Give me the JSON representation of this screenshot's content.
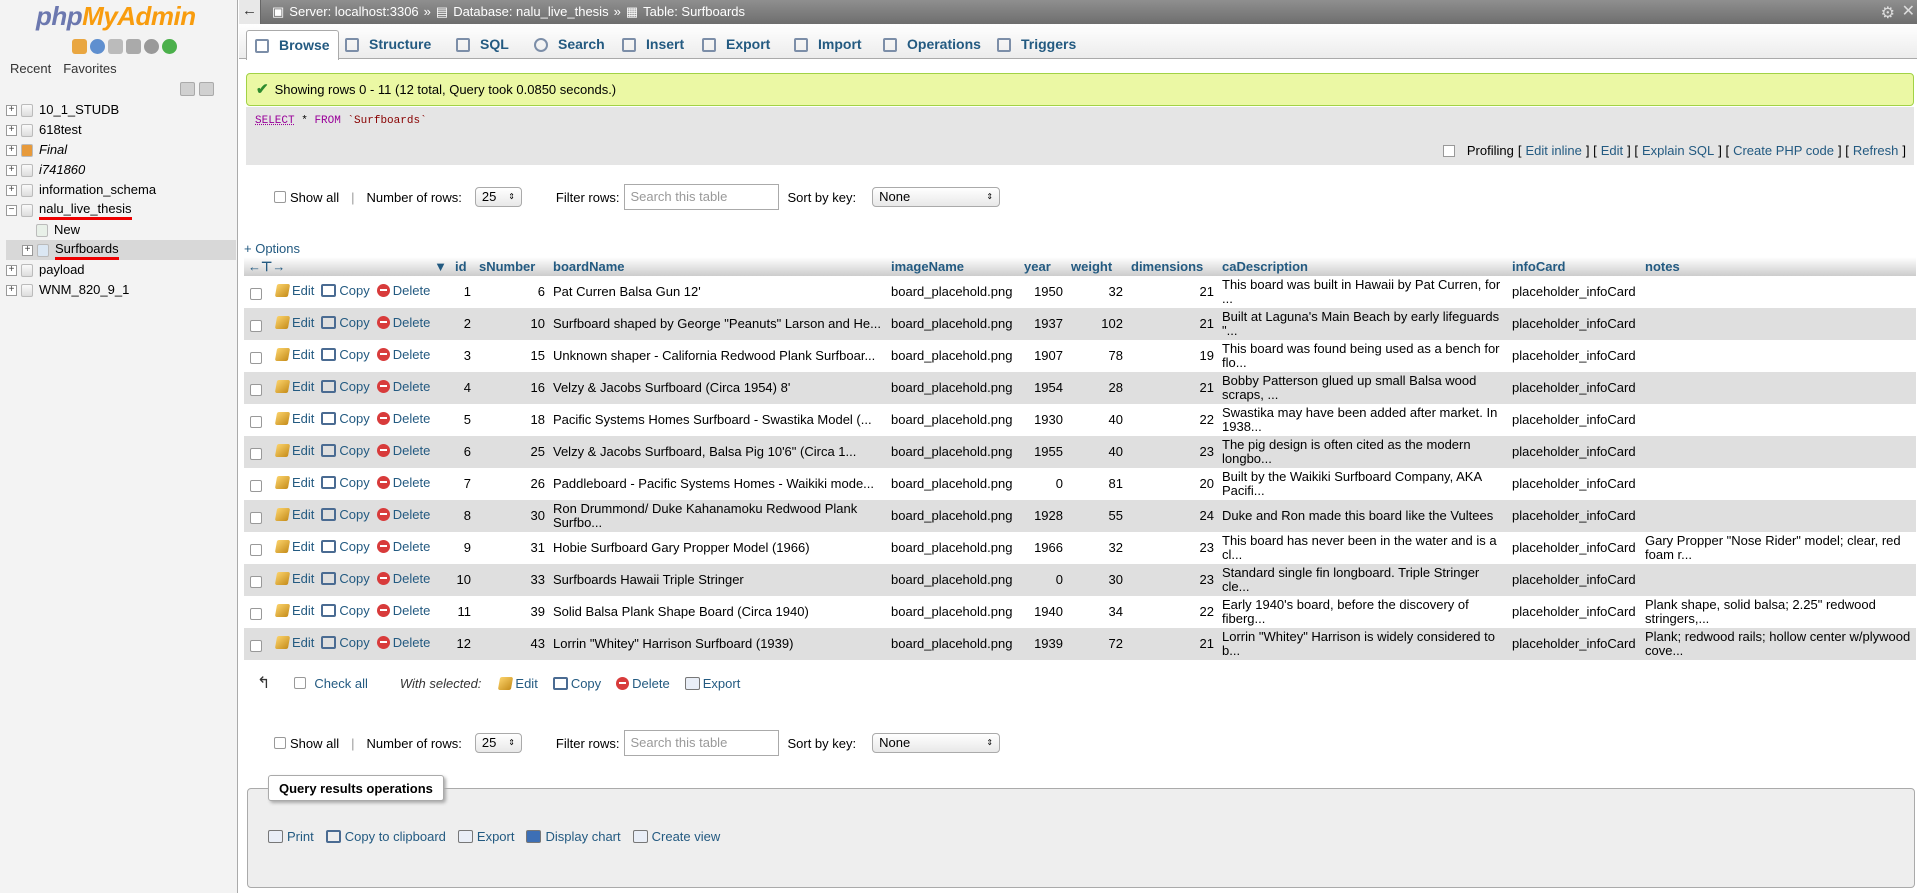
{
  "sidebar": {
    "logo_php": "php",
    "logo_rest": "MyAdmin",
    "tabs": [
      "Recent",
      "Favorites"
    ],
    "databases": [
      {
        "name": "10_1_STUDB",
        "italic": false
      },
      {
        "name": "618test",
        "italic": false
      },
      {
        "name": "Final",
        "italic": true
      },
      {
        "name": "i741860",
        "italic": true
      },
      {
        "name": "information_schema",
        "italic": false
      },
      {
        "name": "nalu_live_thesis",
        "italic": false,
        "expanded": true
      },
      {
        "name": "payload",
        "italic": false
      },
      {
        "name": "WNM_820_9_1",
        "italic": false
      }
    ],
    "children": [
      "New",
      "Surfboards"
    ]
  },
  "topbar": {
    "server": "Server: localhost:3306",
    "database": "Database: nalu_live_thesis",
    "table": "Table: Surfboards",
    "sep": "»"
  },
  "menu": [
    "Browse",
    "Structure",
    "SQL",
    "Search",
    "Insert",
    "Export",
    "Import",
    "Operations",
    "Triggers"
  ],
  "notice": "Showing rows 0 - 11 (12 total, Query took 0.0850 seconds.)",
  "sql": {
    "select": "SELECT",
    "star": "*",
    "from": "FROM",
    "table": "`Surfboards`"
  },
  "sql_links": {
    "profiling": "Profiling",
    "edit_inline": "Edit inline",
    "edit": "Edit",
    "explain": "Explain SQL",
    "php": "Create PHP code",
    "refresh": "Refresh"
  },
  "nav": {
    "show_all": "Show all",
    "num_rows_label": "Number of rows:",
    "num_rows": "25",
    "filter_label": "Filter rows:",
    "filter_placeholder": "Search this table",
    "sort_label": "Sort by key:",
    "sort_value": "None"
  },
  "options_label": "+ Options",
  "columns": [
    "id",
    "sNumber",
    "boardName",
    "imageName",
    "year",
    "weight",
    "dimensions",
    "caDescription",
    "infoCard",
    "notes"
  ],
  "row_actions": {
    "edit": "Edit",
    "copy": "Copy",
    "delete": "Delete"
  },
  "rows": [
    {
      "id": "1",
      "sNumber": "6",
      "boardName": "Pat Curren Balsa Gun 12'",
      "imageName": "board_placehold.png",
      "year": "1950",
      "weight": "32",
      "dimensions": "21",
      "caDescription": "This board was built in Hawaii by Pat Curren, for ...",
      "infoCard": "placeholder_infoCard",
      "notes": ""
    },
    {
      "id": "2",
      "sNumber": "10",
      "boardName": "Surfboard shaped by George \"Peanuts\" Larson and He...",
      "imageName": "board_placehold.png",
      "year": "1937",
      "weight": "102",
      "dimensions": "21",
      "caDescription": "Built at Laguna's Main Beach by early lifeguards \"...",
      "infoCard": "placeholder_infoCard",
      "notes": ""
    },
    {
      "id": "3",
      "sNumber": "15",
      "boardName": "Unknown shaper - California Redwood Plank Surfboar...",
      "imageName": "board_placehold.png",
      "year": "1907",
      "weight": "78",
      "dimensions": "19",
      "caDescription": "This board was found being used as a bench for flo...",
      "infoCard": "placeholder_infoCard",
      "notes": ""
    },
    {
      "id": "4",
      "sNumber": "16",
      "boardName": "Velzy & Jacobs Surfboard (Circa 1954) 8'",
      "imageName": "board_placehold.png",
      "year": "1954",
      "weight": "28",
      "dimensions": "21",
      "caDescription": "Bobby Patterson glued up small Balsa wood scraps, ...",
      "infoCard": "placeholder_infoCard",
      "notes": ""
    },
    {
      "id": "5",
      "sNumber": "18",
      "boardName": "Pacific Systems Homes Surfboard - Swastika Model (...",
      "imageName": "board_placehold.png",
      "year": "1930",
      "weight": "40",
      "dimensions": "22",
      "caDescription": "Swastika may have been added after market. In 1938...",
      "infoCard": "placeholder_infoCard",
      "notes": ""
    },
    {
      "id": "6",
      "sNumber": "25",
      "boardName": "Velzy & Jacobs Surfboard, Balsa Pig 10'6\" (Circa 1...",
      "imageName": "board_placehold.png",
      "year": "1955",
      "weight": "40",
      "dimensions": "23",
      "caDescription": "The pig design is often cited as the modern longbo...",
      "infoCard": "placeholder_infoCard",
      "notes": ""
    },
    {
      "id": "7",
      "sNumber": "26",
      "boardName": "Paddleboard - Pacific Systems Homes - Waikiki mode...",
      "imageName": "board_placehold.png",
      "year": "0",
      "weight": "81",
      "dimensions": "20",
      "caDescription": "Built by the Waikiki Surfboard Company, AKA Pacifi...",
      "infoCard": "placeholder_infoCard",
      "notes": ""
    },
    {
      "id": "8",
      "sNumber": "30",
      "boardName": "Ron Drummond/ Duke Kahanamoku Redwood Plank Surfbo...",
      "imageName": "board_placehold.png",
      "year": "1928",
      "weight": "55",
      "dimensions": "24",
      "caDescription": "Duke and Ron made this board like the Vultees",
      "infoCard": "placeholder_infoCard",
      "notes": ""
    },
    {
      "id": "9",
      "sNumber": "31",
      "boardName": "Hobie Surfboard Gary Propper Model (1966)",
      "imageName": "board_placehold.png",
      "year": "1966",
      "weight": "32",
      "dimensions": "23",
      "caDescription": "This board has never been in the water and is a cl...",
      "infoCard": "placeholder_infoCard",
      "notes": "Gary Propper \"Nose Rider\" model; clear, red foam r..."
    },
    {
      "id": "10",
      "sNumber": "33",
      "boardName": "Surfboards Hawaii Triple Stringer",
      "imageName": "board_placehold.png",
      "year": "0",
      "weight": "30",
      "dimensions": "23",
      "caDescription": "Standard single fin longboard. Triple Stringer cle...",
      "infoCard": "placeholder_infoCard",
      "notes": ""
    },
    {
      "id": "11",
      "sNumber": "39",
      "boardName": "Solid Balsa Plank Shape Board (Circa 1940)",
      "imageName": "board_placehold.png",
      "year": "1940",
      "weight": "34",
      "dimensions": "22",
      "caDescription": "Early 1940's board, before the discovery of fiberg...",
      "infoCard": "placeholder_infoCard",
      "notes": "Plank shape, solid balsa; 2.25\" redwood stringers,..."
    },
    {
      "id": "12",
      "sNumber": "43",
      "boardName": "Lorrin \"Whitey\" Harrison Surfboard (1939)",
      "imageName": "board_placehold.png",
      "year": "1939",
      "weight": "72",
      "dimensions": "21",
      "caDescription": "Lorrin \"Whitey\" Harrison is widely considered to b...",
      "infoCard": "placeholder_infoCard",
      "notes": "Plank; redwood rails; hollow center w/plywood cove..."
    }
  ],
  "bulk": {
    "check_all": "Check all",
    "with_selected": "With selected:",
    "edit": "Edit",
    "copy": "Copy",
    "delete": "Delete",
    "export": "Export"
  },
  "qro": {
    "title": "Query results operations",
    "print": "Print",
    "copy": "Copy to clipboard",
    "export": "Export",
    "chart": "Display chart",
    "view": "Create view"
  },
  "colors": {
    "link": "#235a81",
    "notice_bg": "#ebf8a4",
    "accent_red": "#e00000"
  }
}
